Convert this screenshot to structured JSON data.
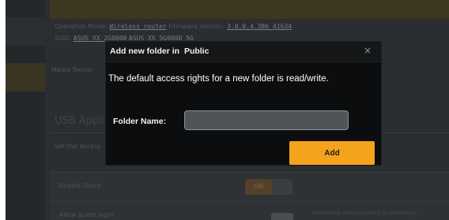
{
  "background": {
    "operation_mode_label": "Operation Mode:",
    "operation_mode_value": "Wireless router",
    "firmware_label": "Firmware Version:",
    "firmware_value": "3.0.0.4.386_41634",
    "ssid_label": "SSID:",
    "ssid_value_1": "ASUS_XX_2G0000",
    "ssid_value_2": "ASUS_XX_5G0000_5G",
    "media_server_label": "Media Server",
    "section_title": "USB Application",
    "section_desc": "Set the access",
    "row_1_label": "Enable Share",
    "row_1_toggle": "ON",
    "row_2_label": "Allow guest login",
    "footnote": "Username and password is necessary"
  },
  "dialog": {
    "title_prefix": "Add new folder in",
    "title_folder": "Public",
    "close_glyph": "×",
    "message": "The default access rights for a new folder is read/write.",
    "folder_name_label": "Folder Name:",
    "folder_name_value": "",
    "add_button_label": "Add"
  },
  "colors": {
    "accent": "#f5a31c",
    "dialog_background": "#0c0d0e",
    "page_background": "#2b2e30"
  }
}
